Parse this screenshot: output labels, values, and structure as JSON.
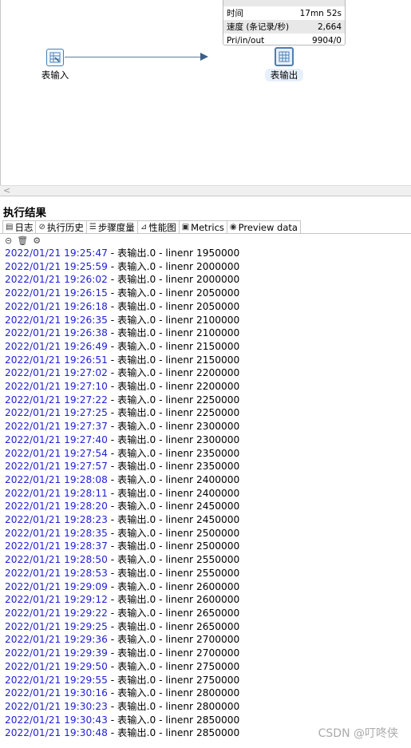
{
  "tooltip": {
    "rows": [
      {
        "label": "",
        "value": ""
      },
      {
        "label": "时间",
        "value": "17mn 52s"
      },
      {
        "label": "速度 (条记录/秒)",
        "value": "2,664"
      },
      {
        "label": "Pri/in/out",
        "value": "9904/0"
      }
    ]
  },
  "steps": {
    "input_label": "表输入",
    "output_label": "表输出"
  },
  "results": {
    "title": "执行结果",
    "tabs": [
      "日志",
      "执行历史",
      "步骤度量",
      "性能图",
      "Metrics",
      "Preview data"
    ]
  },
  "log_lines": [
    {
      "ts": "2022/01/21 19:25:47",
      "msg": " - 表输出.0 - linenr 1950000"
    },
    {
      "ts": "2022/01/21 19:25:59",
      "msg": " - 表输入.0 - linenr 2000000"
    },
    {
      "ts": "2022/01/21 19:26:02",
      "msg": " - 表输出.0 - linenr 2000000"
    },
    {
      "ts": "2022/01/21 19:26:15",
      "msg": " - 表输入.0 - linenr 2050000"
    },
    {
      "ts": "2022/01/21 19:26:18",
      "msg": " - 表输出.0 - linenr 2050000"
    },
    {
      "ts": "2022/01/21 19:26:35",
      "msg": " - 表输入.0 - linenr 2100000"
    },
    {
      "ts": "2022/01/21 19:26:38",
      "msg": " - 表输出.0 - linenr 2100000"
    },
    {
      "ts": "2022/01/21 19:26:49",
      "msg": " - 表输入.0 - linenr 2150000"
    },
    {
      "ts": "2022/01/21 19:26:51",
      "msg": " - 表输出.0 - linenr 2150000"
    },
    {
      "ts": "2022/01/21 19:27:02",
      "msg": " - 表输入.0 - linenr 2200000"
    },
    {
      "ts": "2022/01/21 19:27:10",
      "msg": " - 表输出.0 - linenr 2200000"
    },
    {
      "ts": "2022/01/21 19:27:22",
      "msg": " - 表输入.0 - linenr 2250000"
    },
    {
      "ts": "2022/01/21 19:27:25",
      "msg": " - 表输出.0 - linenr 2250000"
    },
    {
      "ts": "2022/01/21 19:27:37",
      "msg": " - 表输入.0 - linenr 2300000"
    },
    {
      "ts": "2022/01/21 19:27:40",
      "msg": " - 表输出.0 - linenr 2300000"
    },
    {
      "ts": "2022/01/21 19:27:54",
      "msg": " - 表输入.0 - linenr 2350000"
    },
    {
      "ts": "2022/01/21 19:27:57",
      "msg": " - 表输出.0 - linenr 2350000"
    },
    {
      "ts": "2022/01/21 19:28:08",
      "msg": " - 表输入.0 - linenr 2400000"
    },
    {
      "ts": "2022/01/21 19:28:11",
      "msg": " - 表输出.0 - linenr 2400000"
    },
    {
      "ts": "2022/01/21 19:28:20",
      "msg": " - 表输入.0 - linenr 2450000"
    },
    {
      "ts": "2022/01/21 19:28:23",
      "msg": " - 表输出.0 - linenr 2450000"
    },
    {
      "ts": "2022/01/21 19:28:35",
      "msg": " - 表输入.0 - linenr 2500000"
    },
    {
      "ts": "2022/01/21 19:28:37",
      "msg": " - 表输出.0 - linenr 2500000"
    },
    {
      "ts": "2022/01/21 19:28:50",
      "msg": " - 表输入.0 - linenr 2550000"
    },
    {
      "ts": "2022/01/21 19:28:53",
      "msg": " - 表输出.0 - linenr 2550000"
    },
    {
      "ts": "2022/01/21 19:29:09",
      "msg": " - 表输入.0 - linenr 2600000"
    },
    {
      "ts": "2022/01/21 19:29:12",
      "msg": " - 表输出.0 - linenr 2600000"
    },
    {
      "ts": "2022/01/21 19:29:22",
      "msg": " - 表输入.0 - linenr 2650000"
    },
    {
      "ts": "2022/01/21 19:29:25",
      "msg": " - 表输出.0 - linenr 2650000"
    },
    {
      "ts": "2022/01/21 19:29:36",
      "msg": " - 表输入.0 - linenr 2700000"
    },
    {
      "ts": "2022/01/21 19:29:39",
      "msg": " - 表输出.0 - linenr 2700000"
    },
    {
      "ts": "2022/01/21 19:29:50",
      "msg": " - 表输入.0 - linenr 2750000"
    },
    {
      "ts": "2022/01/21 19:29:55",
      "msg": " - 表输出.0 - linenr 2750000"
    },
    {
      "ts": "2022/01/21 19:30:16",
      "msg": " - 表输入.0 - linenr 2800000"
    },
    {
      "ts": "2022/01/21 19:30:23",
      "msg": " - 表输出.0 - linenr 2800000"
    },
    {
      "ts": "2022/01/21 19:30:43",
      "msg": " - 表输入.0 - linenr 2850000"
    },
    {
      "ts": "2022/01/21 19:30:48",
      "msg": " - 表输出.0 - linenr 2850000"
    }
  ],
  "watermark": "CSDN @叮咚侠",
  "colors": {
    "timestamp": "#1f1fd6",
    "step_border": "#4a7fb4"
  }
}
